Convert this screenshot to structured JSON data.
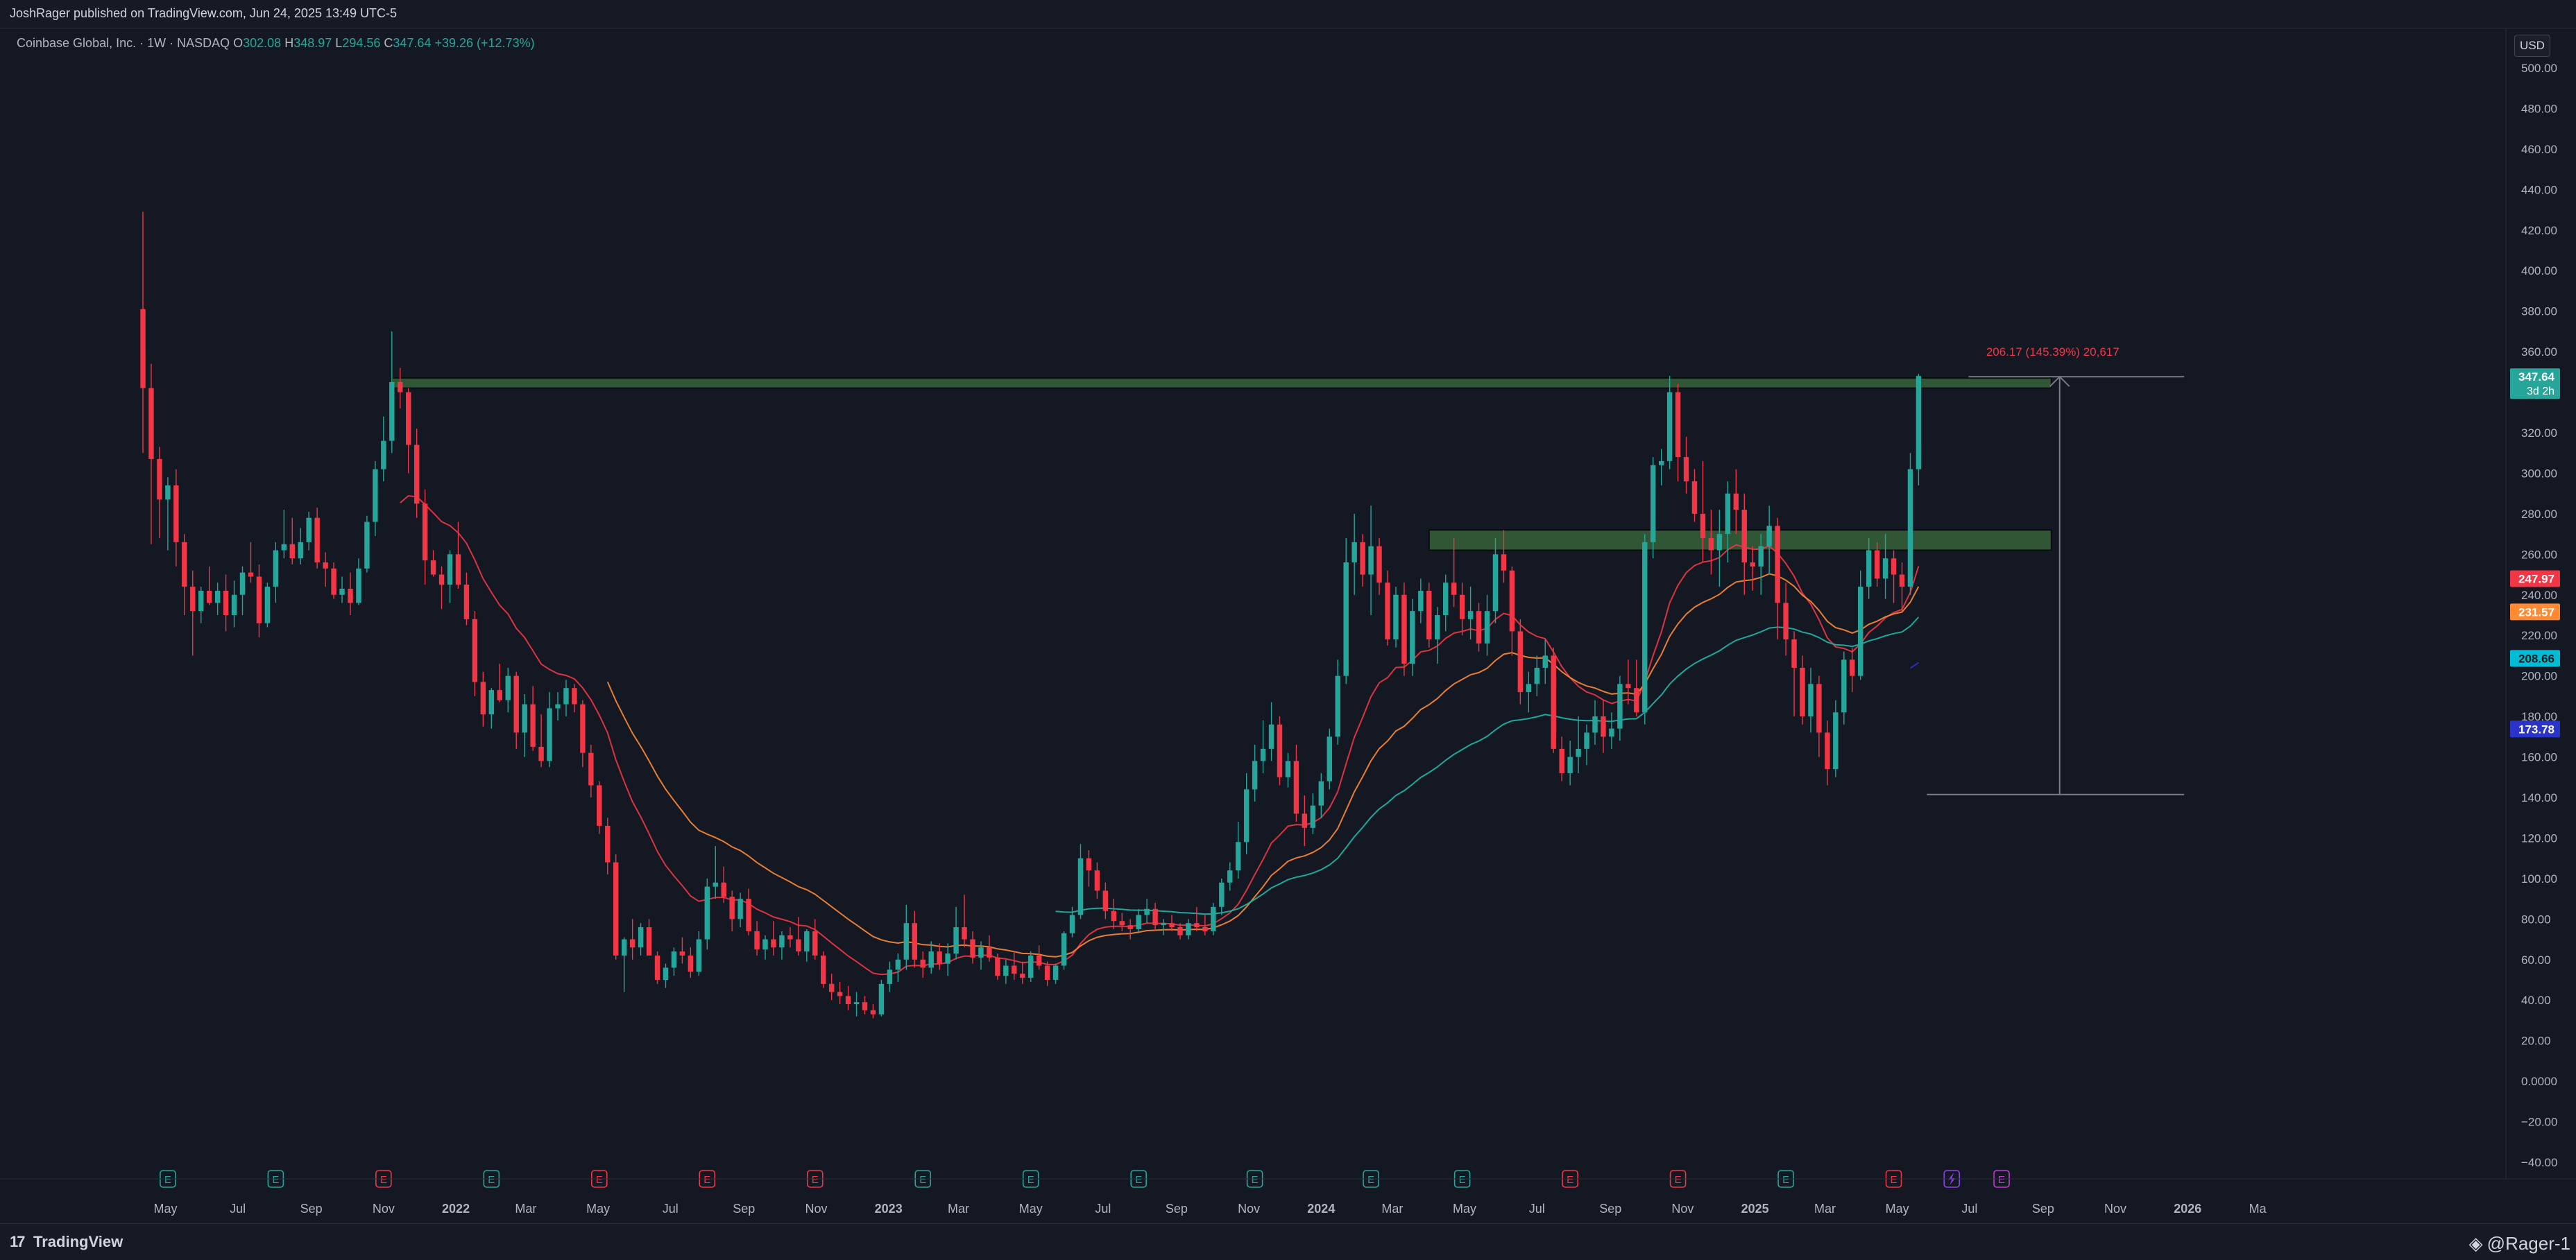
{
  "header": {
    "published": "JoshRager published on TradingView.com, Jun 24, 2025 13:49 UTC-5",
    "symbol": "Coinbase Global, Inc. · 1W · NASDAQ",
    "ohlc": {
      "o_label": "O",
      "o": "302.08",
      "h_label": "H",
      "h": "348.97",
      "l_label": "L",
      "l": "294.56",
      "c_label": "C",
      "c": "347.64",
      "change": "+39.26 (+12.73%)"
    },
    "currency": "USD"
  },
  "footer": {
    "brand": "TradingView",
    "brand_icon": "tv-logo-icon",
    "author": "@Rager-1",
    "author_icon": "diamond-icon"
  },
  "colors": {
    "background": "#141823",
    "up": "#26a69a",
    "down": "#f23645",
    "ma_red": "#f23645",
    "ma_orange": "#ff8a34",
    "ma_teal": "#1fb8a8",
    "ma_blue": "#2b34c8",
    "zone": "#3a6b3c",
    "measure": "#787b86"
  },
  "chart_data": {
    "type": "candlestick",
    "interval": "1W",
    "ylim": [
      -40,
      500
    ],
    "y_ticks": [
      "500.00",
      "480.00",
      "460.00",
      "440.00",
      "420.00",
      "400.00",
      "380.00",
      "360.00",
      "340.00",
      "320.00",
      "300.00",
      "280.00",
      "260.00",
      "240.00",
      "220.00",
      "200.00",
      "180.00",
      "160.00",
      "140.00",
      "120.00",
      "100.00",
      "80.00",
      "60.00",
      "40.00",
      "20.00",
      "0.0000",
      "−20.00",
      "−40.00"
    ],
    "x_ticks": [
      "May",
      "Jul",
      "Sep",
      "Nov",
      "2022",
      "Mar",
      "May",
      "Jul",
      "Sep",
      "Nov",
      "2023",
      "Mar",
      "May",
      "Jul",
      "Sep",
      "Nov",
      "2024",
      "Mar",
      "May",
      "Jul",
      "Sep",
      "Nov",
      "2025",
      "Mar",
      "May",
      "Jul",
      "Sep",
      "Nov",
      "2026",
      "Ma"
    ],
    "x_tick_dates": [
      "2021-05-01",
      "2021-07-01",
      "2021-09-01",
      "2021-11-01",
      "2022-01-01",
      "2022-03-01",
      "2022-05-01",
      "2022-07-01",
      "2022-09-01",
      "2022-11-01",
      "2023-01-01",
      "2023-03-01",
      "2023-05-01",
      "2023-07-01",
      "2023-09-01",
      "2023-11-01",
      "2024-01-01",
      "2024-03-01",
      "2024-05-01",
      "2024-07-01",
      "2024-09-01",
      "2024-11-01",
      "2025-01-01",
      "2025-03-01",
      "2025-05-01",
      "2025-07-01",
      "2025-09-01",
      "2025-11-01",
      "2026-01-01",
      "2026-03-01"
    ],
    "first_bar_date": "2021-04-12",
    "bar_interval_days": 7,
    "candles": [
      [
        381,
        429,
        310,
        342
      ],
      [
        342,
        354,
        265,
        307
      ],
      [
        307,
        313,
        268,
        287
      ],
      [
        287,
        298,
        262,
        294
      ],
      [
        294,
        302,
        254,
        266
      ],
      [
        266,
        270,
        230,
        244
      ],
      [
        244,
        252,
        210,
        232
      ],
      [
        232,
        244,
        226,
        242
      ],
      [
        242,
        254,
        235,
        236
      ],
      [
        236,
        246,
        230,
        242
      ],
      [
        242,
        250,
        222,
        230
      ],
      [
        230,
        247,
        224,
        240
      ],
      [
        240,
        254,
        230,
        251
      ],
      [
        251,
        266,
        246,
        249
      ],
      [
        249,
        255,
        219,
        226
      ],
      [
        226,
        246,
        224,
        244
      ],
      [
        244,
        266,
        236,
        262
      ],
      [
        262,
        282,
        258,
        265
      ],
      [
        265,
        278,
        255,
        258
      ],
      [
        258,
        273,
        255,
        266
      ],
      [
        266,
        281,
        262,
        278
      ],
      [
        278,
        283,
        253,
        256
      ],
      [
        256,
        261,
        244,
        253
      ],
      [
        253,
        256,
        238,
        240
      ],
      [
        240,
        249,
        236,
        243
      ],
      [
        243,
        251,
        230,
        236
      ],
      [
        236,
        258,
        235,
        253
      ],
      [
        253,
        279,
        251,
        276
      ],
      [
        276,
        306,
        269,
        302
      ],
      [
        302,
        328,
        296,
        316
      ],
      [
        316,
        370,
        310,
        345
      ],
      [
        345,
        352,
        332,
        340
      ],
      [
        340,
        342,
        300,
        314
      ],
      [
        314,
        322,
        278,
        285
      ],
      [
        285,
        292,
        245,
        257
      ],
      [
        257,
        262,
        249,
        250
      ],
      [
        250,
        254,
        233,
        245
      ],
      [
        245,
        262,
        236,
        260
      ],
      [
        260,
        276,
        243,
        245
      ],
      [
        245,
        251,
        225,
        228
      ],
      [
        228,
        232,
        190,
        197
      ],
      [
        197,
        202,
        175,
        181
      ],
      [
        181,
        194,
        174,
        193
      ],
      [
        193,
        206,
        187,
        188
      ],
      [
        188,
        204,
        182,
        200
      ],
      [
        200,
        202,
        164,
        172
      ],
      [
        172,
        191,
        160,
        186
      ],
      [
        186,
        195,
        163,
        165
      ],
      [
        165,
        181,
        155,
        158
      ],
      [
        158,
        192,
        155,
        184
      ],
      [
        184,
        192,
        178,
        186
      ],
      [
        186,
        198,
        180,
        194
      ],
      [
        194,
        196,
        182,
        186
      ],
      [
        186,
        188,
        155,
        162
      ],
      [
        162,
        166,
        140,
        146
      ],
      [
        146,
        148,
        122,
        126
      ],
      [
        126,
        130,
        102,
        108
      ],
      [
        108,
        112,
        60,
        62
      ],
      [
        62,
        71,
        44,
        70
      ],
      [
        70,
        80,
        60,
        66
      ],
      [
        66,
        78,
        62,
        76
      ],
      [
        76,
        80,
        62,
        62
      ],
      [
        62,
        64,
        48,
        50
      ],
      [
        50,
        58,
        46,
        56
      ],
      [
        56,
        66,
        52,
        64
      ],
      [
        64,
        71,
        58,
        62
      ],
      [
        62,
        66,
        51,
        54
      ],
      [
        54,
        74,
        52,
        70
      ],
      [
        70,
        100,
        65,
        96
      ],
      [
        96,
        116,
        90,
        98
      ],
      [
        98,
        106,
        88,
        91
      ],
      [
        91,
        94,
        74,
        80
      ],
      [
        80,
        93,
        76,
        90
      ],
      [
        90,
        95,
        72,
        74
      ],
      [
        74,
        79,
        62,
        65
      ],
      [
        65,
        72,
        60,
        70
      ],
      [
        70,
        79,
        62,
        66
      ],
      [
        66,
        74,
        60,
        72
      ],
      [
        72,
        76,
        66,
        70
      ],
      [
        70,
        81,
        62,
        64
      ],
      [
        64,
        75,
        59,
        74
      ],
      [
        74,
        80,
        60,
        62
      ],
      [
        62,
        64,
        46,
        48
      ],
      [
        48,
        53,
        40,
        44
      ],
      [
        44,
        49,
        38,
        42
      ],
      [
        42,
        47,
        35,
        38
      ],
      [
        38,
        44,
        32,
        39
      ],
      [
        39,
        42,
        33,
        35
      ],
      [
        35,
        38,
        31,
        33
      ],
      [
        33,
        50,
        32,
        48
      ],
      [
        48,
        59,
        44,
        55
      ],
      [
        55,
        63,
        49,
        60
      ],
      [
        60,
        87,
        55,
        78
      ],
      [
        78,
        84,
        56,
        60
      ],
      [
        60,
        64,
        51,
        56
      ],
      [
        56,
        69,
        53,
        64
      ],
      [
        64,
        68,
        55,
        58
      ],
      [
        58,
        68,
        52,
        63
      ],
      [
        63,
        86,
        60,
        76
      ],
      [
        76,
        92,
        66,
        70
      ],
      [
        70,
        74,
        58,
        61
      ],
      [
        61,
        69,
        55,
        66
      ],
      [
        66,
        72,
        59,
        61
      ],
      [
        61,
        63,
        50,
        52
      ],
      [
        52,
        60,
        48,
        57
      ],
      [
        57,
        64,
        50,
        53
      ],
      [
        53,
        59,
        48,
        51
      ],
      [
        51,
        64,
        49,
        62
      ],
      [
        62,
        67,
        55,
        57
      ],
      [
        57,
        59,
        47,
        50
      ],
      [
        50,
        58,
        48,
        57
      ],
      [
        57,
        74,
        55,
        73
      ],
      [
        73,
        86,
        71,
        82
      ],
      [
        82,
        117,
        80,
        110
      ],
      [
        110,
        114,
        96,
        104
      ],
      [
        104,
        108,
        90,
        94
      ],
      [
        94,
        98,
        80,
        84
      ],
      [
        84,
        90,
        75,
        79
      ],
      [
        79,
        83,
        74,
        77
      ],
      [
        77,
        80,
        70,
        75
      ],
      [
        75,
        85,
        73,
        82
      ],
      [
        82,
        90,
        78,
        85
      ],
      [
        85,
        88,
        74,
        77
      ],
      [
        77,
        80,
        72,
        78
      ],
      [
        78,
        82,
        74,
        76
      ],
      [
        76,
        78,
        70,
        72
      ],
      [
        72,
        80,
        70,
        78
      ],
      [
        78,
        86,
        74,
        76
      ],
      [
        76,
        82,
        72,
        74
      ],
      [
        74,
        88,
        72,
        86
      ],
      [
        86,
        100,
        82,
        98
      ],
      [
        98,
        108,
        94,
        104
      ],
      [
        104,
        128,
        100,
        118
      ],
      [
        118,
        152,
        112,
        144
      ],
      [
        144,
        166,
        138,
        158
      ],
      [
        158,
        178,
        152,
        164
      ],
      [
        164,
        187,
        158,
        176
      ],
      [
        176,
        180,
        146,
        150
      ],
      [
        150,
        162,
        145,
        158
      ],
      [
        158,
        166,
        128,
        132
      ],
      [
        132,
        141,
        116,
        125
      ],
      [
        125,
        142,
        122,
        136
      ],
      [
        136,
        152,
        130,
        148
      ],
      [
        148,
        174,
        144,
        170
      ],
      [
        170,
        208,
        166,
        200
      ],
      [
        200,
        268,
        196,
        256
      ],
      [
        256,
        280,
        240,
        266
      ],
      [
        266,
        270,
        244,
        250
      ],
      [
        250,
        284,
        230,
        264
      ],
      [
        264,
        268,
        240,
        246
      ],
      [
        246,
        252,
        215,
        218
      ],
      [
        218,
        244,
        214,
        240
      ],
      [
        240,
        246,
        200,
        206
      ],
      [
        206,
        238,
        200,
        232
      ],
      [
        232,
        248,
        226,
        242
      ],
      [
        242,
        246,
        214,
        218
      ],
      [
        218,
        234,
        206,
        230
      ],
      [
        230,
        250,
        222,
        246
      ],
      [
        246,
        268,
        234,
        240
      ],
      [
        240,
        246,
        220,
        228
      ],
      [
        228,
        244,
        218,
        232
      ],
      [
        232,
        236,
        212,
        216
      ],
      [
        216,
        240,
        210,
        232
      ],
      [
        232,
        268,
        226,
        260
      ],
      [
        260,
        272,
        246,
        252
      ],
      [
        252,
        254,
        210,
        222
      ],
      [
        222,
        228,
        186,
        192
      ],
      [
        192,
        202,
        182,
        196
      ],
      [
        196,
        210,
        190,
        204
      ],
      [
        204,
        218,
        196,
        210
      ],
      [
        210,
        214,
        162,
        164
      ],
      [
        164,
        170,
        148,
        152
      ],
      [
        152,
        168,
        146,
        160
      ],
      [
        160,
        180,
        152,
        164
      ],
      [
        164,
        176,
        156,
        172
      ],
      [
        172,
        188,
        166,
        180
      ],
      [
        180,
        188,
        162,
        170
      ],
      [
        170,
        182,
        164,
        174
      ],
      [
        174,
        200,
        168,
        196
      ],
      [
        196,
        208,
        186,
        194
      ],
      [
        194,
        208,
        180,
        182
      ],
      [
        182,
        270,
        176,
        266
      ],
      [
        266,
        308,
        258,
        304
      ],
      [
        304,
        312,
        294,
        306
      ],
      [
        306,
        348,
        302,
        340
      ],
      [
        340,
        344,
        296,
        308
      ],
      [
        308,
        318,
        290,
        296
      ],
      [
        296,
        302,
        276,
        280
      ],
      [
        280,
        306,
        256,
        268
      ],
      [
        268,
        282,
        250,
        262
      ],
      [
        262,
        282,
        244,
        270
      ],
      [
        270,
        296,
        256,
        290
      ],
      [
        290,
        302,
        270,
        282
      ],
      [
        282,
        290,
        240,
        256
      ],
      [
        256,
        264,
        242,
        254
      ],
      [
        254,
        270,
        240,
        264
      ],
      [
        264,
        284,
        250,
        274
      ],
      [
        274,
        278,
        218,
        236
      ],
      [
        236,
        246,
        210,
        218
      ],
      [
        218,
        222,
        180,
        204
      ],
      [
        204,
        210,
        176,
        180
      ],
      [
        180,
        204,
        172,
        196
      ],
      [
        196,
        200,
        160,
        172
      ],
      [
        172,
        178,
        146,
        154
      ],
      [
        154,
        188,
        150,
        182
      ],
      [
        182,
        212,
        176,
        208
      ],
      [
        208,
        214,
        192,
        200
      ],
      [
        200,
        252,
        198,
        244
      ],
      [
        244,
        268,
        238,
        262
      ],
      [
        262,
        266,
        244,
        248
      ],
      [
        248,
        270,
        238,
        258
      ],
      [
        258,
        262,
        236,
        250
      ],
      [
        250,
        256,
        232,
        244
      ],
      [
        244,
        310,
        240,
        302
      ],
      [
        302,
        349,
        294,
        348
      ]
    ],
    "moving_averages": [
      {
        "color": "#f23645",
        "last_label": "247.97",
        "start_bar": 31
      },
      {
        "color": "#ff8a34",
        "last_label": "231.57",
        "start_bar": 56
      },
      {
        "color": "#1fb8a8",
        "last_label": "208.66",
        "start_bar": 110
      },
      {
        "color": "#2b34c8",
        "last_label": "173.78",
        "start_bar": 213
      }
    ],
    "zones": [
      {
        "y_low": 342,
        "y_high": 347,
        "from_bar": 30,
        "to_bar": 230
      },
      {
        "y_low": 262,
        "y_high": 272,
        "from_bar": 155,
        "to_bar": 230
      }
    ],
    "measure": {
      "y_from": 141.47,
      "y_to": 347.64,
      "from_bar": 215,
      "to_bar": 243,
      "label": "206.17 (145.39%) 20,617"
    },
    "last_price": "347.64",
    "countdown": "3d 2h",
    "events": [
      {
        "label": "E",
        "color": "#26a69a",
        "bar": 3
      },
      {
        "label": "E",
        "color": "#26a69a",
        "bar": 16
      },
      {
        "label": "E",
        "color": "#f23645",
        "bar": 29
      },
      {
        "label": "E",
        "color": "#26a69a",
        "bar": 42
      },
      {
        "label": "E",
        "color": "#f23645",
        "bar": 55
      },
      {
        "label": "E",
        "color": "#f23645",
        "bar": 68
      },
      {
        "label": "E",
        "color": "#f23645",
        "bar": 81
      },
      {
        "label": "E",
        "color": "#26a69a",
        "bar": 94
      },
      {
        "label": "E",
        "color": "#26a69a",
        "bar": 107
      },
      {
        "label": "E",
        "color": "#26a69a",
        "bar": 120
      },
      {
        "label": "E",
        "color": "#26a69a",
        "bar": 134
      },
      {
        "label": "E",
        "color": "#26a69a",
        "bar": 148
      },
      {
        "label": "E",
        "color": "#26a69a",
        "bar": 159
      },
      {
        "label": "E",
        "color": "#f23645",
        "bar": 172
      },
      {
        "label": "E",
        "color": "#f23645",
        "bar": 185
      },
      {
        "label": "E",
        "color": "#26a69a",
        "bar": 198
      },
      {
        "label": "E",
        "color": "#f23645",
        "bar": 211
      },
      {
        "label": "",
        "color": "#8e44ec",
        "bar": 218,
        "icon": "lightning-icon"
      },
      {
        "label": "E",
        "color": "#c33bd4",
        "bar": 224
      }
    ]
  }
}
